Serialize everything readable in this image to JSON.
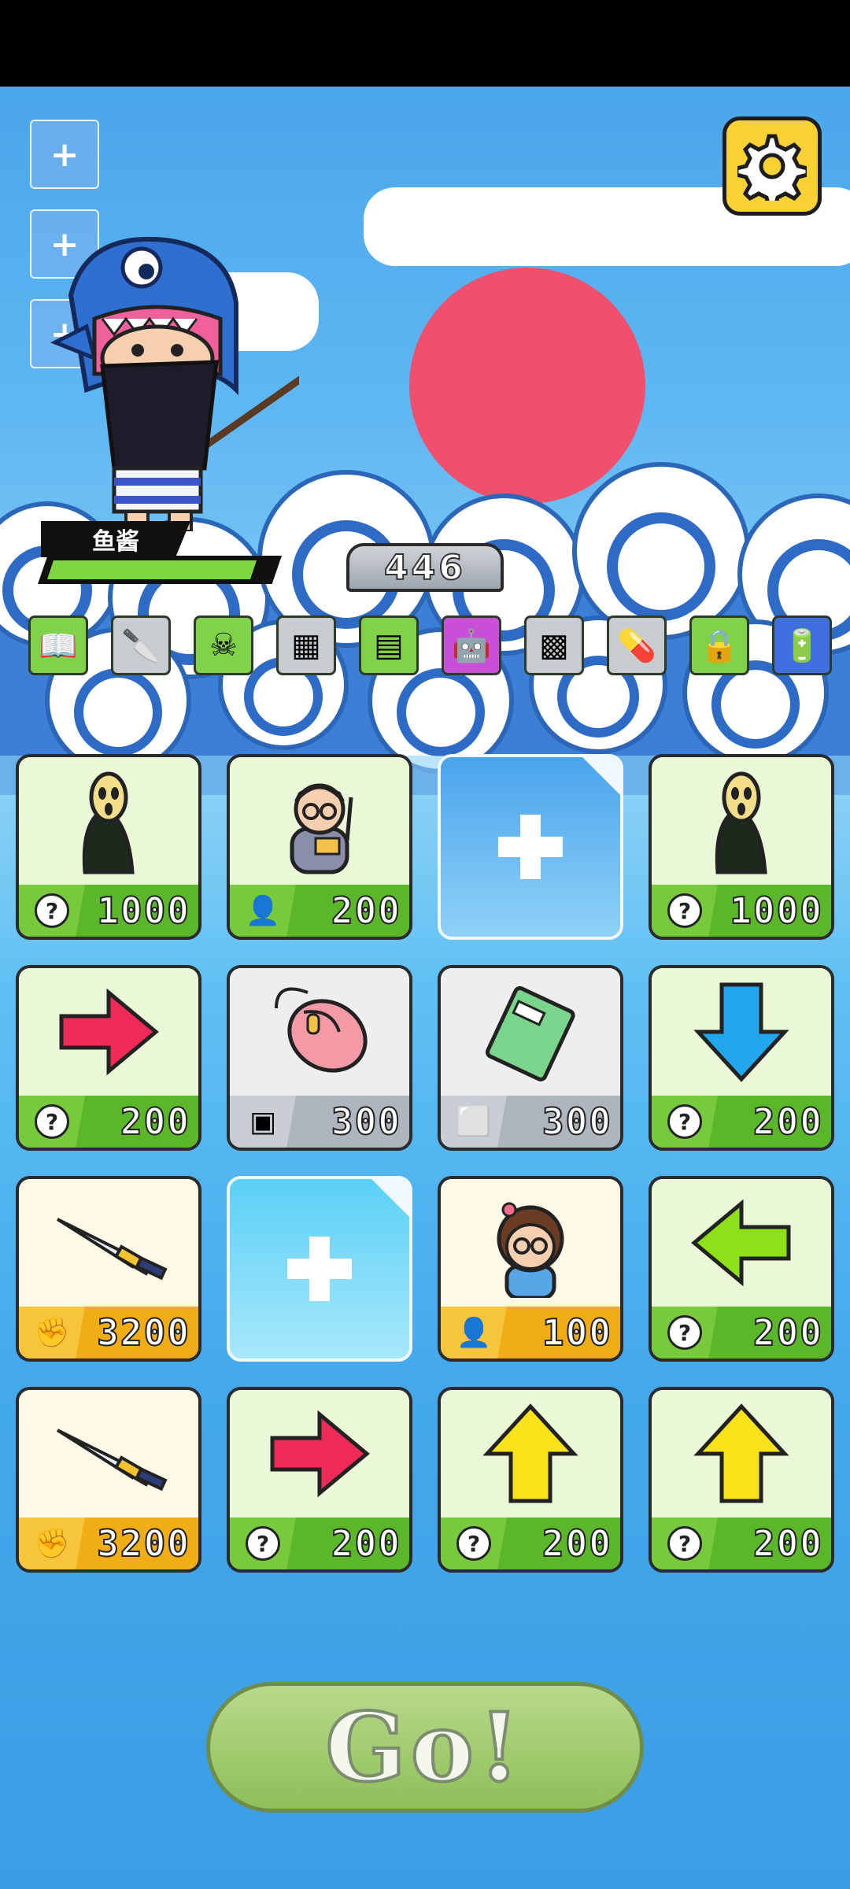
{
  "player": {
    "name": "鱼酱",
    "hp_fraction": 0.93
  },
  "score": "446",
  "top_buttons": [
    {
      "label": "+"
    },
    {
      "label": "+"
    },
    {
      "label": "+"
    }
  ],
  "items": [
    {
      "icon": "open-book-icon",
      "color": "#7fd24a"
    },
    {
      "icon": "cleaver-icon",
      "color": "#c7ccd1"
    },
    {
      "icon": "pirate-skull-icon",
      "color": "#7fd24a"
    },
    {
      "icon": "circuit-board-icon",
      "color": "#c7ccd1"
    },
    {
      "icon": "green-notebook-icon",
      "color": "#7fd24a"
    },
    {
      "icon": "robot-icon",
      "color": "#c84fd6"
    },
    {
      "icon": "net-icon",
      "color": "#c7ccd1"
    },
    {
      "icon": "pill-bottle-icon",
      "color": "#c7ccd1"
    },
    {
      "icon": "padlock-icon",
      "color": "#7fd24a"
    },
    {
      "icon": "battery-icon",
      "color": "#3f6fe0"
    }
  ],
  "cards": [
    {
      "type": "green",
      "art": "scream-figure-icon",
      "cost_icon": "question-icon",
      "cost": "1000"
    },
    {
      "type": "green",
      "art": "teacher-icon",
      "cost_icon": "person-icon",
      "cost": "200"
    },
    {
      "type": "empty1"
    },
    {
      "type": "green",
      "art": "scream-figure-icon",
      "cost_icon": "question-icon",
      "cost": "1000"
    },
    {
      "type": "green",
      "art": "arrow-right-icon",
      "cost_icon": "question-icon",
      "cost": "200"
    },
    {
      "type": "gray",
      "art": "mouse-icon",
      "cost_icon": "chip-icon",
      "cost": "300"
    },
    {
      "type": "gray",
      "art": "english-book-icon",
      "cost_icon": "eraser-icon",
      "cost": "300"
    },
    {
      "type": "green",
      "art": "arrow-down-icon",
      "cost_icon": "question-icon",
      "cost": "200"
    },
    {
      "type": "gold",
      "art": "sword-icon",
      "cost_icon": "fist-icon",
      "cost": "3200"
    },
    {
      "type": "empty2"
    },
    {
      "type": "gold",
      "art": "girl-student-icon",
      "cost_icon": "person-icon",
      "cost": "100"
    },
    {
      "type": "green",
      "art": "arrow-left-icon",
      "cost_icon": "question-icon",
      "cost": "200"
    },
    {
      "type": "gold",
      "art": "sword-icon",
      "cost_icon": "fist-icon",
      "cost": "3200"
    },
    {
      "type": "green",
      "art": "arrow-right-icon",
      "cost_icon": "question-icon",
      "cost": "200"
    },
    {
      "type": "green",
      "art": "arrow-up-icon",
      "cost_icon": "question-icon",
      "cost": "200"
    },
    {
      "type": "green",
      "art": "arrow-up-icon",
      "cost_icon": "question-icon",
      "cost": "200"
    }
  ],
  "go_label": "Go!"
}
